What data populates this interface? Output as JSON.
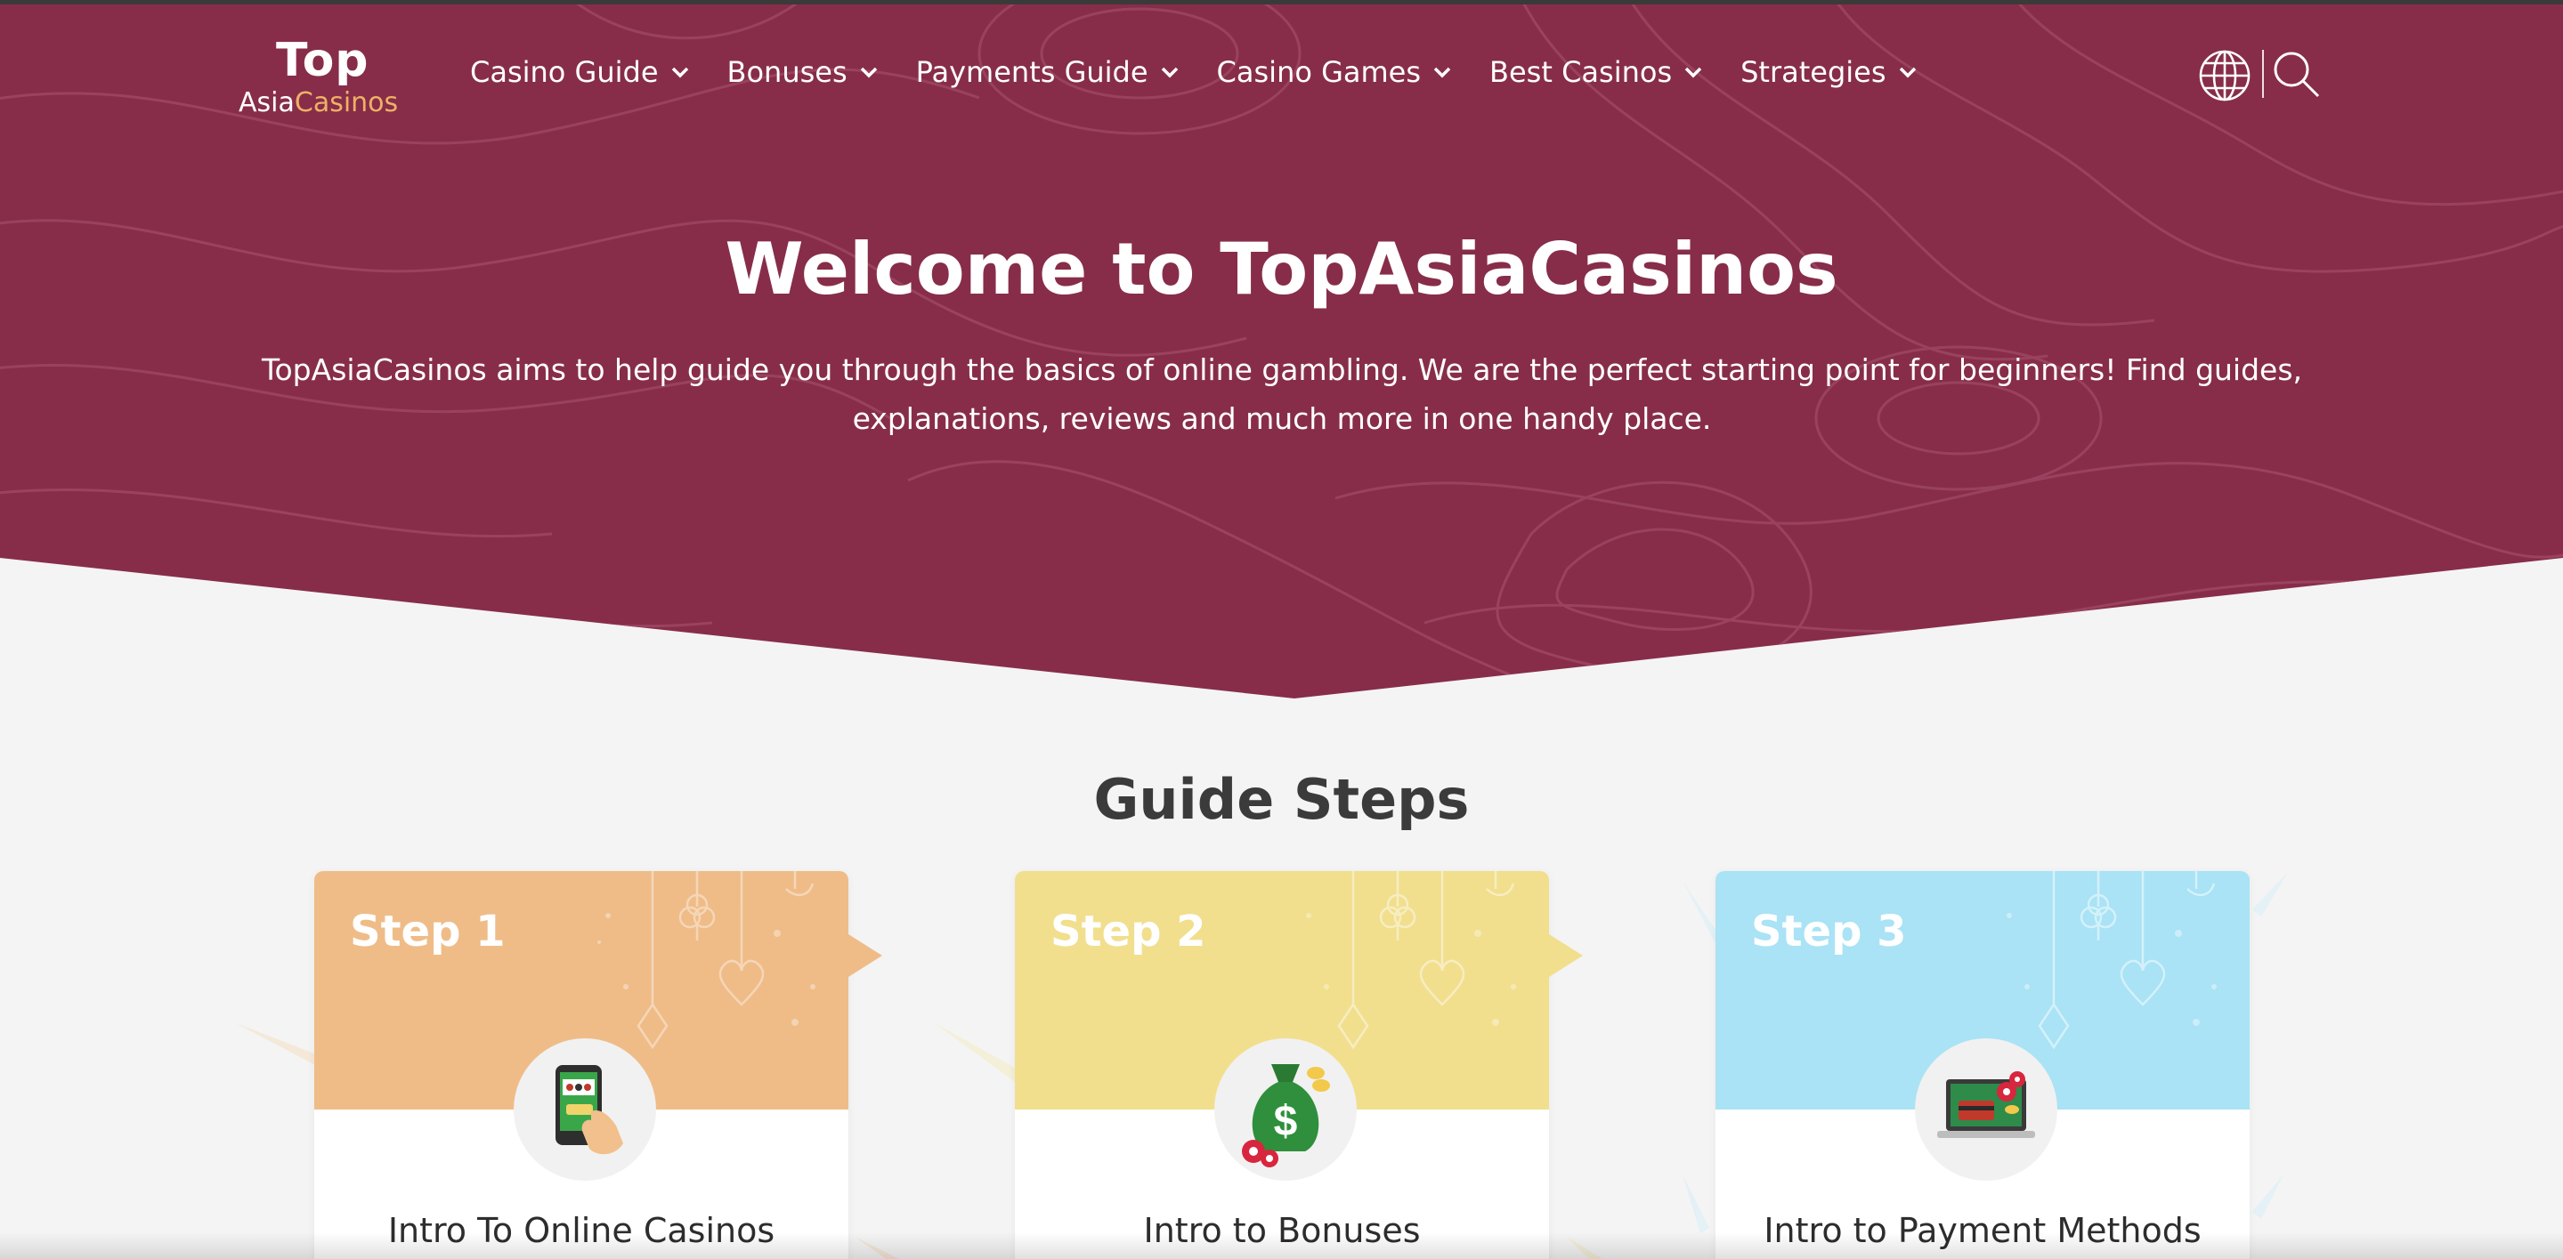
{
  "header": {
    "logo": {
      "top": "Top",
      "asia": "Asia",
      "casinos": "Casinos"
    },
    "nav": [
      {
        "label": "Casino Guide"
      },
      {
        "label": "Bonuses"
      },
      {
        "label": "Payments Guide"
      },
      {
        "label": "Casino Games"
      },
      {
        "label": "Best Casinos"
      },
      {
        "label": "Strategies"
      }
    ],
    "icons": {
      "language": "globe-icon",
      "search": "search-icon",
      "dropdown": "chevron-down-icon"
    }
  },
  "hero": {
    "title": "Welcome to TopAsiaCasinos",
    "text": "TopAsiaCasinos aims to help guide you through the basics of online gambling. We are the perfect starting point for beginners! Find guides, explanations, reviews and much more in one handy place."
  },
  "guide": {
    "title": "Guide Steps",
    "steps": [
      {
        "label": "Step 1",
        "title": "Intro To Online Casinos",
        "icon": "slot-phone-icon",
        "color": "#efbc88"
      },
      {
        "label": "Step 2",
        "title": "Intro to Bonuses",
        "icon": "money-bag-icon",
        "color": "#f1df8e"
      },
      {
        "label": "Step 3",
        "title": "Intro to Payment Methods",
        "icon": "laptop-card-icon",
        "color": "#a9e3f5"
      }
    ]
  },
  "colors": {
    "hero_bg": "#872d4a",
    "page_bg": "#f4f4f4",
    "logo_accent": "#efb165"
  }
}
